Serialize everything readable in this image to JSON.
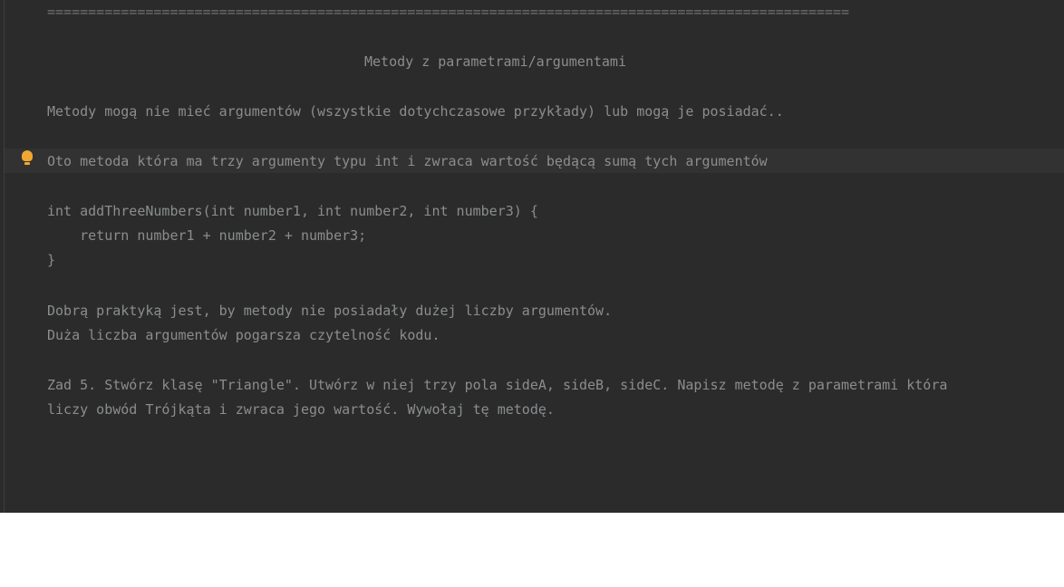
{
  "editor": {
    "separator": "==================================================================================================",
    "heading": "Metody z parametrami/argumentami",
    "paragraph1": "Metody mogą nie mieć argumentów (wszystkie dotychczasowe przykłady) lub mogą je posiadać..",
    "paragraph2": "Oto metoda która ma trzy argumenty typu int i zwraca wartość będącą sumą tych argumentów",
    "code": {
      "line1": "int addThreeNumbers(int number1, int number2, int number3) {",
      "line2": "    return number1 + number2 + number3;",
      "line3": "}"
    },
    "tip1": "Dobrą praktyką jest, by metody nie posiadały dużej liczby argumentów.",
    "tip2": "Duża liczba argumentów pogarsza czytelność kodu.",
    "task_line1": "Zad 5. Stwórz klasę \"Triangle\". Utwórz w niej trzy pola sideA, sideB, sideC. Napisz metodę z parametrami która",
    "task_line2": "liczy obwód Trójkąta i zwraca jego wartość. Wywołaj tę metodę.",
    "intention_icon": "lightbulb-icon"
  },
  "colors": {
    "editor_background": "#2b2b2b",
    "text": "#8a8d8f",
    "current_line": "#323232",
    "bulb": "#f0a732"
  }
}
